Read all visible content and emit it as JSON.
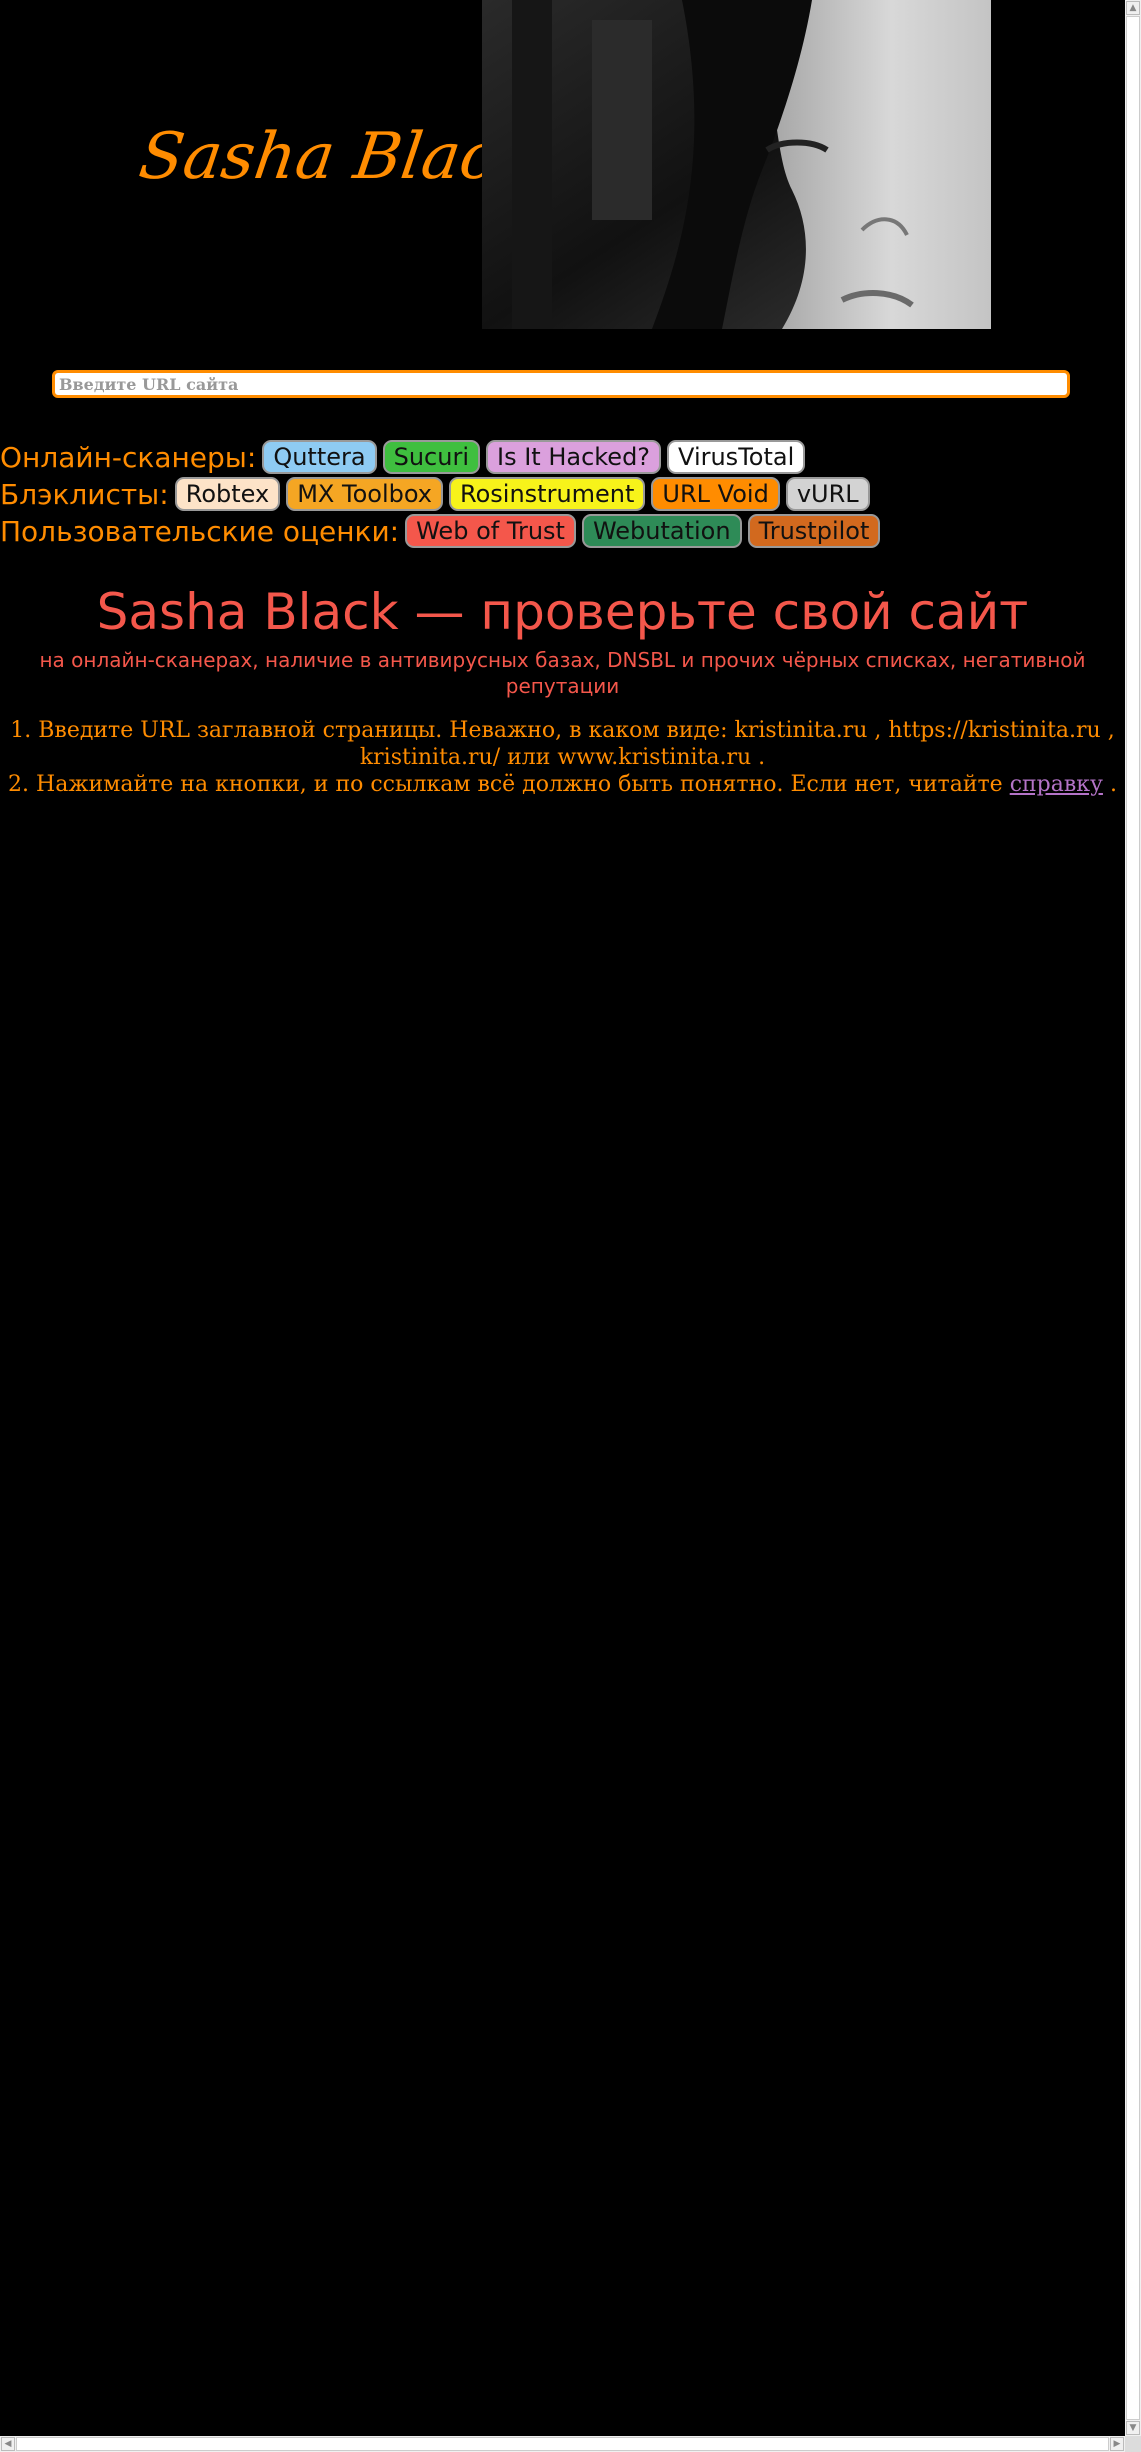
{
  "header": {
    "logo_text": "Sasha Black"
  },
  "search": {
    "placeholder": "Введите URL сайта"
  },
  "scanners": {
    "label": "Онлайн-сканеры:",
    "buttons": [
      "Quttera",
      "Sucuri",
      "Is It Hacked?",
      "VirusTotal"
    ],
    "colors": [
      "#8ecbf3",
      "#3fbf3f",
      "#dba0dd",
      "#ffffff"
    ]
  },
  "blacklists": {
    "label": "Блэклисты:",
    "buttons": [
      "Robtex",
      "MX Toolbox",
      "Rosinstrument",
      "URL Void",
      "vURL"
    ],
    "colors": [
      "#fde3c8",
      "#f5a623",
      "#f7f31a",
      "#ff8c00",
      "#d3d3d3"
    ]
  },
  "ratings": {
    "label": "Пользовательские оценки:",
    "buttons": [
      "Web of Trust",
      "Webutation",
      "Trustpilot"
    ],
    "colors": [
      "#f4574b",
      "#2e8b57",
      "#d2691e"
    ]
  },
  "main": {
    "title": "Sasha Black — проверьте свой сайт",
    "subtitle": "на онлайн-сканерах, наличие в антивирусных базах, DNSBL и прочих чёрных списках, негативной репутации",
    "step1": "1. Введите URL заглавной страницы. Неважно, в каком виде: kristinita.ru , https://kristinita.ru , kristinita.ru/ или www.kristinita.ru .",
    "step2_prefix": "2. Нажимайте на кнопки, и по ссылкам всё должно быть понятно. Если нет, читайте",
    "help_link": "справку",
    "step2_suffix": "."
  },
  "theme": {
    "background": "#000000",
    "accent": "#ff8c00",
    "title_color": "#f4574b",
    "link_color": "#b473c8"
  }
}
